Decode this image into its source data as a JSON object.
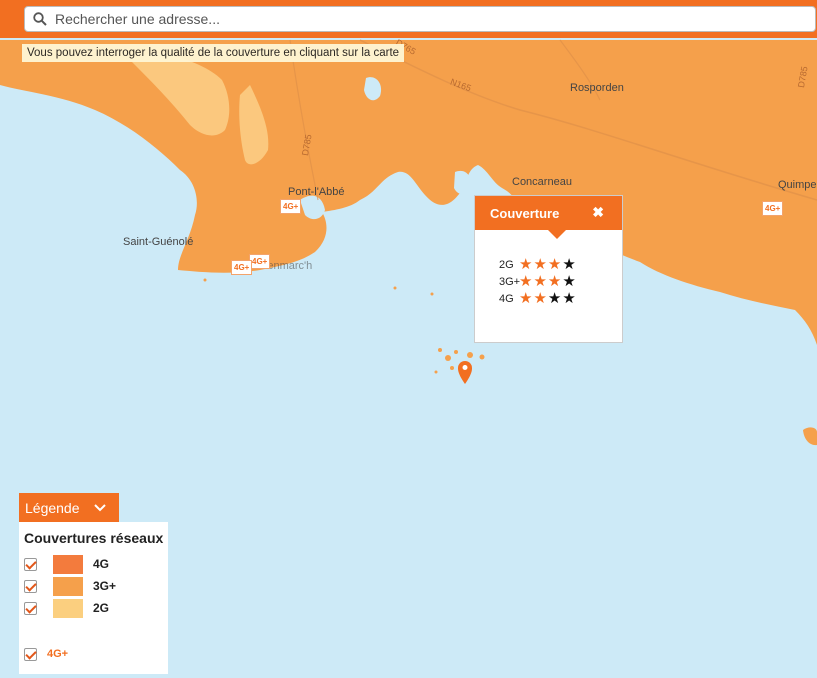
{
  "search": {
    "placeholder": "Rechercher une adresse..."
  },
  "hint": "Vous pouvez interroger la qualité de la couverture en cliquant sur la carte",
  "map": {
    "places": [
      "Rosporden",
      "Pont-l'Abbé",
      "Concarneau",
      "Quimper",
      "Saint-Guénolé",
      "Penmarc'h"
    ],
    "roads": [
      "D765",
      "N165",
      "D785",
      "D785"
    ],
    "badges": [
      "4G+",
      "4G+",
      "4G+",
      "4G+"
    ],
    "colors": {
      "sea": "#cdeaf7",
      "coverage_3g": "#f5a04b",
      "coverage_2g": "#fbc87e",
      "coverage_4g": "#f37b3d",
      "accent": "#f26f21"
    }
  },
  "popup": {
    "title": "Couverture",
    "close_icon": "close-icon",
    "rows": [
      {
        "label": "2G",
        "stars": 3,
        "max": 4
      },
      {
        "label": "3G+",
        "stars": 3,
        "max": 4
      },
      {
        "label": "4G",
        "stars": 2,
        "max": 4
      }
    ]
  },
  "legend": {
    "button_label": "Légende",
    "title": "Couvertures réseaux",
    "items": [
      {
        "label": "4G",
        "color": "#f37b3d",
        "checked": true
      },
      {
        "label": "3G+",
        "color": "#f5a04b",
        "checked": true
      },
      {
        "label": "2G",
        "color": "#fbcf7f",
        "checked": true
      },
      {
        "label": "4G+",
        "color": "#f26f21",
        "checked": true
      }
    ]
  }
}
